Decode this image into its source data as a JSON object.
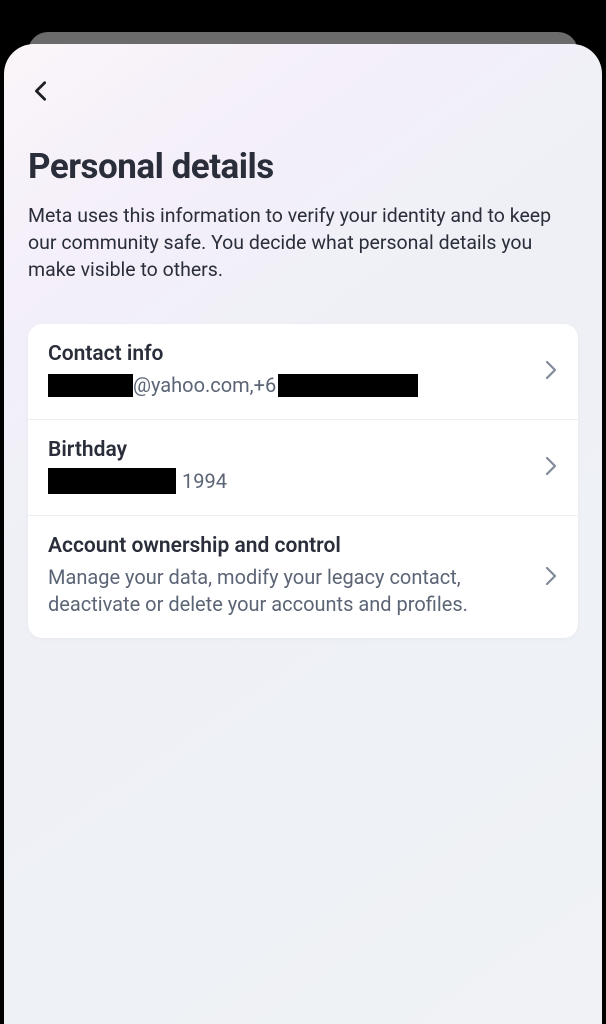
{
  "header": {
    "title": "Personal details",
    "description": "Meta uses this information to verify your identity and to keep our community safe. You decide what personal details you make visible to others."
  },
  "rows": {
    "contact": {
      "title": "Contact info",
      "email_suffix": "@yahoo.com, ",
      "phone_prefix": "+6"
    },
    "birthday": {
      "title": "Birthday",
      "year": "1994"
    },
    "ownership": {
      "title": "Account ownership and control",
      "subtitle": "Manage your data, modify your legacy contact, deactivate or delete your accounts and profiles."
    }
  }
}
